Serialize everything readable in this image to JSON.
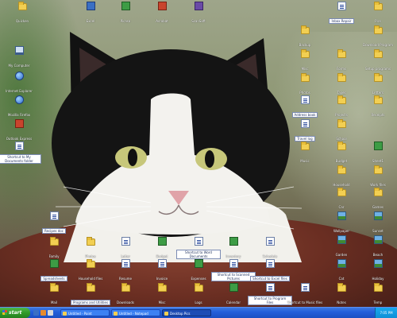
{
  "desktop": {
    "wallpaper_subject": "black-and-white cat",
    "icons_top": [
      {
        "label": "Quicken",
        "icon": "folder-icon"
      },
      {
        "label": "Excel",
        "icon": "app-icon"
      },
      {
        "label": "Picasa",
        "icon": "app-green-icon"
      },
      {
        "label": "Acrobat",
        "icon": "app-red-icon"
      },
      {
        "label": "ScanSoft",
        "icon": "app-purple-icon"
      },
      {
        "label": "Inbox Repair",
        "icon": "doc-icon"
      },
      {
        "label": "Pics",
        "icon": "folder-icon"
      }
    ],
    "icons_left": [
      {
        "label": "My Computer",
        "icon": "computer-icon"
      },
      {
        "label": "Internet Explorer",
        "icon": "globe-icon"
      },
      {
        "label": "Mozilla Firefox",
        "icon": "globe-icon"
      },
      {
        "label": "Outlook Express",
        "icon": "app-red-icon"
      },
      {
        "label": "Shortcut to My Documents folder",
        "icon": "doc-icon"
      }
    ],
    "icons_right": [
      {
        "label": "Backup",
        "icon": "folder-icon"
      },
      {
        "label": "Download Program",
        "icon": "folder-icon"
      },
      {
        "label": "Misc",
        "icon": "folder-icon"
      },
      {
        "label": "Forms",
        "icon": "folder-icon"
      },
      {
        "label": "Setup programs",
        "icon": "folder-icon"
      },
      {
        "label": "Photos",
        "icon": "folder-icon"
      },
      {
        "label": "Taxes",
        "icon": "folder-icon"
      },
      {
        "label": "Letters",
        "icon": "folder-icon"
      },
      {
        "label": "Address book",
        "icon": "doc-icon"
      },
      {
        "label": "Projects",
        "icon": "folder-icon"
      },
      {
        "label": "Receipts",
        "icon": "folder-icon"
      },
      {
        "label": "Travel log",
        "icon": "doc-icon"
      },
      {
        "label": "School",
        "icon": "folder-icon"
      },
      {
        "label": "Music",
        "icon": "folder-icon"
      },
      {
        "label": "Budget",
        "icon": "folder-icon"
      },
      {
        "label": "Recipes",
        "icon": "folder-icon"
      },
      {
        "label": "Household",
        "icon": "folder-icon"
      },
      {
        "label": "Work files",
        "icon": "folder-icon"
      },
      {
        "label": "Car",
        "icon": "folder-icon"
      },
      {
        "label": "Games",
        "icon": "folder-icon"
      },
      {
        "label": "Sheet1",
        "icon": "app-green-icon"
      },
      {
        "label": "Old files",
        "icon": "folder-icon"
      },
      {
        "label": "Archive",
        "icon": "folder-icon"
      },
      {
        "label": "Saved Pictures",
        "icon": "folder-icon"
      },
      {
        "label": "Wallpaper",
        "icon": "image-icon"
      },
      {
        "label": "Sunset",
        "icon": "image-icon"
      },
      {
        "label": "Garden",
        "icon": "image-icon"
      },
      {
        "label": "Beach",
        "icon": "image-icon"
      },
      {
        "label": "Cat",
        "icon": "image-icon"
      },
      {
        "label": "Holiday",
        "icon": "image-icon"
      },
      {
        "label": "Notes",
        "icon": "folder-icon"
      },
      {
        "label": "Temp",
        "icon": "folder-icon"
      }
    ],
    "icons_bottom": [
      {
        "label": "Recipes doc",
        "icon": "doc-icon"
      },
      {
        "label": "Family",
        "icon": "folder-icon"
      },
      {
        "label": "Photos",
        "icon": "folder-icon"
      },
      {
        "label": "Letter",
        "icon": "doc-icon"
      },
      {
        "label": "Budget",
        "icon": "app-green-icon"
      },
      {
        "label": "Shortcut to Word Documents",
        "icon": "doc-icon"
      },
      {
        "label": "Inventory",
        "icon": "app-green-icon"
      },
      {
        "label": "Schedule",
        "icon": "doc-icon"
      },
      {
        "label": "Spreadsheets",
        "icon": "app-green-icon"
      },
      {
        "label": "Household files",
        "icon": "folder-icon"
      },
      {
        "label": "Resume",
        "icon": "doc-icon"
      },
      {
        "label": "Invoice",
        "icon": "doc-icon"
      },
      {
        "label": "Expenses",
        "icon": "app-green-icon"
      },
      {
        "label": "Shortcut to Scanned Pictures",
        "icon": "doc-icon"
      },
      {
        "label": "Shortcut to Excel files",
        "icon": "doc-icon"
      },
      {
        "label": "Mail",
        "icon": "folder-icon"
      },
      {
        "label": "Programs and Utilities",
        "icon": "folder-icon"
      },
      {
        "label": "Downloads",
        "icon": "folder-icon"
      },
      {
        "label": "Misc",
        "icon": "folder-icon"
      },
      {
        "label": "Logs",
        "icon": "folder-icon"
      },
      {
        "label": "Calendar",
        "icon": "app-green-icon"
      },
      {
        "label": "Shortcut to Program Files",
        "icon": "doc-icon"
      },
      {
        "label": "Shortcut to Music files",
        "icon": "doc-icon"
      }
    ]
  },
  "taskbar": {
    "start_label": "start",
    "tasks": [
      {
        "label": "Untitled - Paint",
        "active": false
      },
      {
        "label": "Untitled - Notepad",
        "active": false
      },
      {
        "label": "Desktop Pics",
        "active": true
      }
    ],
    "clock": "7:05 PM"
  }
}
